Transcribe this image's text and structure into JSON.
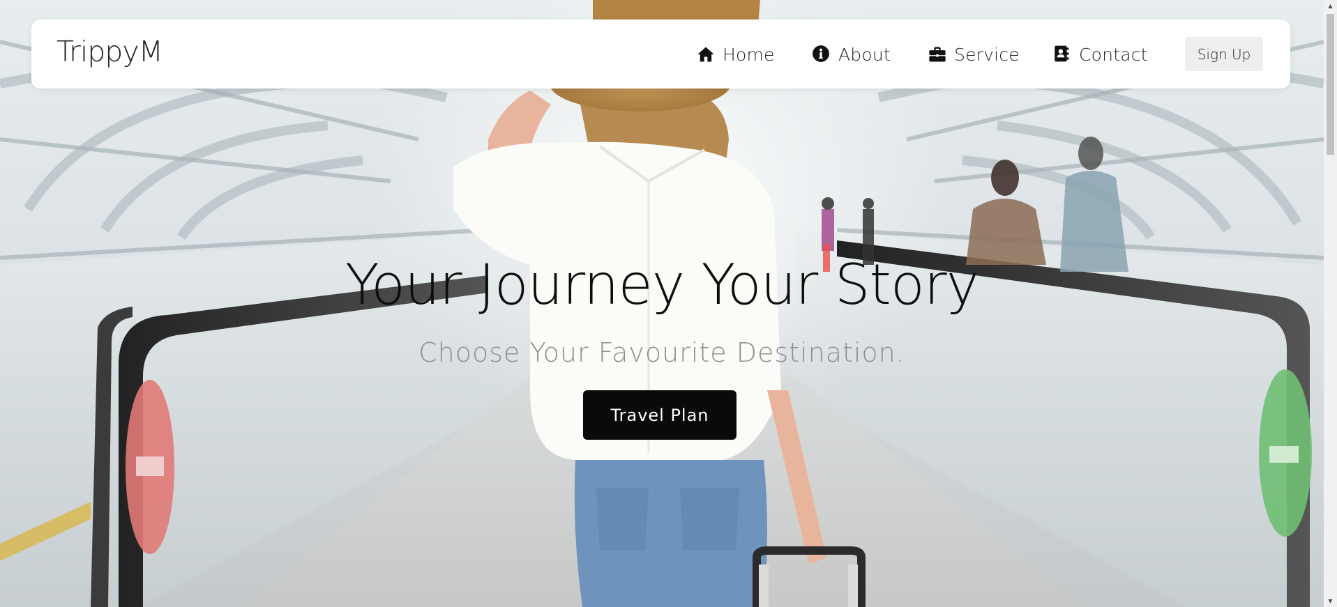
{
  "brand": {
    "name": "TrippyM"
  },
  "nav": {
    "items": [
      {
        "label": "Home",
        "icon": "home-icon"
      },
      {
        "label": "About",
        "icon": "info-circle-icon"
      },
      {
        "label": "Service",
        "icon": "briefcase-icon"
      },
      {
        "label": "Contact",
        "icon": "address-book-icon"
      }
    ],
    "signup_label": "Sign Up"
  },
  "hero": {
    "headline": "Your Journey Your Story",
    "subheadline": "Choose Your Favourite Destination.",
    "cta_label": "Travel Plan"
  },
  "colors": {
    "navbar_bg": "#ffffff",
    "cta_bg": "#0a0a0a",
    "cta_text": "#ffffff",
    "signup_bg": "#eeeeee",
    "subheadline_text": "#8e8e8e"
  }
}
